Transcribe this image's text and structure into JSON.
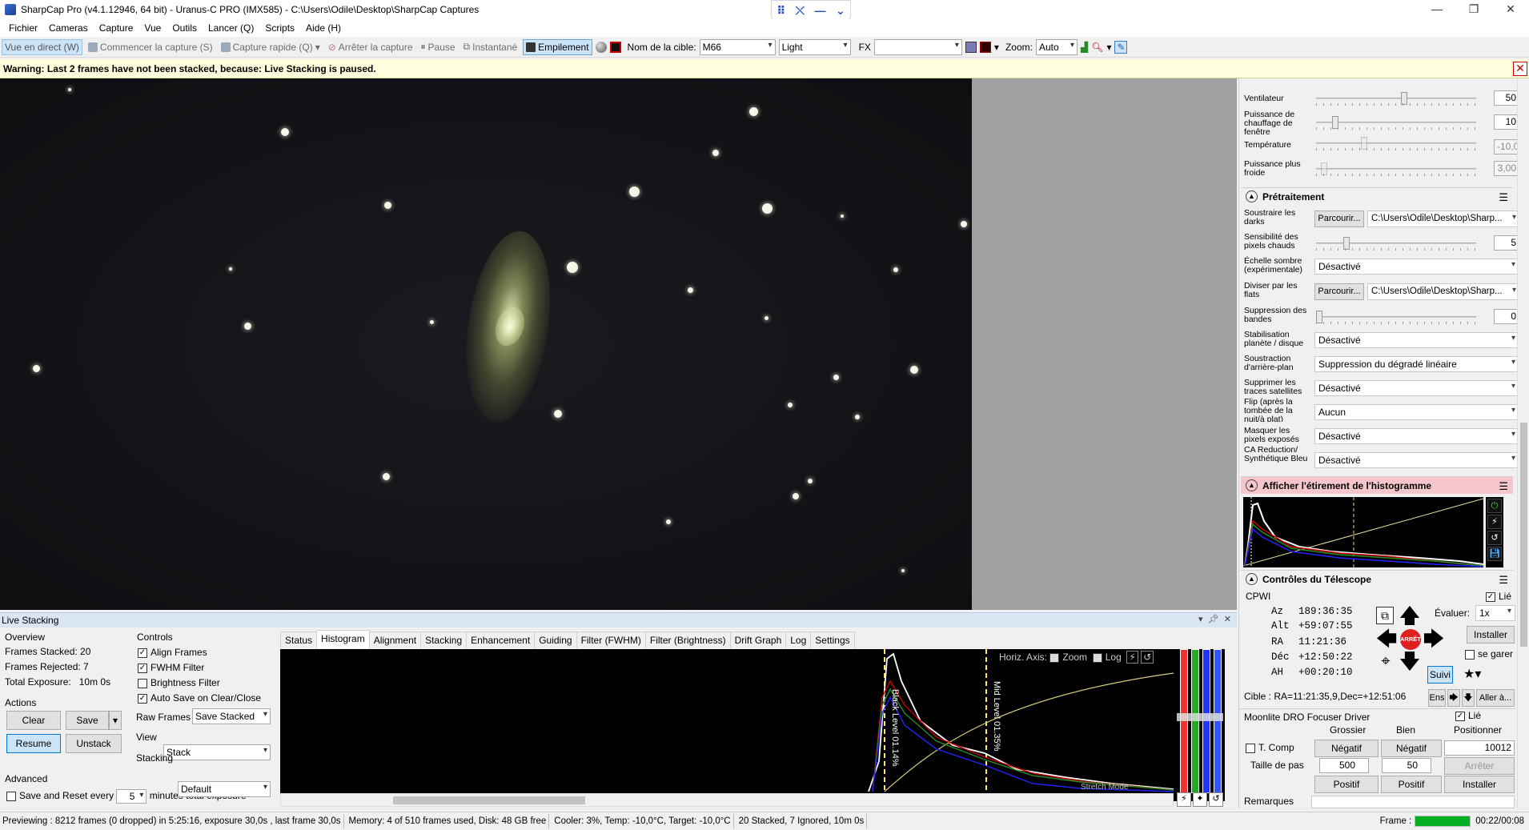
{
  "window": {
    "title": "SharpCap Pro (v4.1.12946, 64 bit) - Uranus-C PRO (IMX585) - C:\\Users\\Odile\\Desktop\\SharpCap Captures",
    "controls": [
      "—",
      "❐",
      "✕"
    ]
  },
  "menu": [
    "Fichier",
    "Cameras",
    "Capture",
    "Vue",
    "Outils",
    "Lancer (Q)",
    "Scripts",
    "Aide (H)"
  ],
  "toolbar": {
    "live_view": "Vue en direct (W)",
    "start_capture": "Commencer la capture (S)",
    "quick_capture": "Capture rapide (Q)",
    "stop_capture": "Arrêter la capture",
    "pause": "Pause",
    "snapshot": "Instantané",
    "stacking": "Empilement",
    "target_label": "Nom de la cible:",
    "target_value": "M66",
    "frame_type": "Light",
    "fx_label": "FX",
    "fx_value": "",
    "zoom_label": "Zoom:",
    "zoom_value": "Auto"
  },
  "warning": "Warning: Last 2 frames have not been stacked, because: Live Stacking is paused.",
  "right_panel": {
    "camera_rows": [
      {
        "label": "Ventilateur",
        "value": "50",
        "level": 0.45,
        "disabled": false
      },
      {
        "label": "Puissance de chauffage de fenêtre",
        "value": "10",
        "level": 0.1,
        "disabled": false
      },
      {
        "label": "Température",
        "value": "-10,0",
        "level": 0.25,
        "disabled": true
      },
      {
        "label": "Puissance plus froide",
        "value": "3,00",
        "level": 0.03,
        "disabled": true
      }
    ],
    "preprocessing": {
      "title": "Prétraitement",
      "subtract_darks_label": "Soustraire les darks",
      "browse_label": "Parcourir...",
      "darks_path": "C:\\Users\\Odile\\Desktop\\Sharp...",
      "hot_pixel_label": "Sensibilité des pixels chauds",
      "hot_pixel_value": "5",
      "dark_scale_label": "Échelle sombre (expérimentale)",
      "dark_scale_value": "Désactivé",
      "flats_label": "Diviser par les flats",
      "flats_path": "C:\\Users\\Odile\\Desktop\\Sharp...",
      "banding_label": "Suppression des bandes",
      "banding_value": "0",
      "stabilization_label": "Stabilisation planète / disque",
      "stabilization_value": "Désactivé",
      "background_label": "Soustraction d'arrière-plan",
      "background_value": "Suppression du dégradé linéaire",
      "satellite_label": "Supprimer les traces satellites",
      "satellite_value": "Désactivé",
      "flip_label": "Flip (après la tombée de la nuit/à plat)",
      "flip_value": "Aucun",
      "mask_label": "Masquer les pixels exposés",
      "mask_value": "Désactivé",
      "synthetic_label": "CA Reduction/ Synthétique Bleu",
      "synthetic_value": "Désactivé"
    },
    "histogram_title": "Afficher l'étirement de l'histogramme",
    "telescope": {
      "title": "Contrôles du Télescope",
      "driver": "CPWI",
      "linked_label": "Lié",
      "az_label": "Az",
      "az": "189:36:35",
      "alt_label": "Alt",
      "alt": "+59:07:55",
      "ra_label": "RA",
      "ra": "11:21:36",
      "dec_label": "Déc",
      "dec": "+12:50:22",
      "ha_label": "AH",
      "ha": "+00:20:10",
      "stop_label": "ARRÊTE",
      "evaluate_label": "Évaluer:",
      "rate_value": "1x",
      "install_label": "Installer",
      "park_label": "se garer",
      "track_label": "Suivi",
      "target_text": "Cible : RA=11:21:35,9,Dec=+12:51:06",
      "set_label": "Ens",
      "goto_label": "Aller à..."
    },
    "focuser": {
      "title": "Moonlite DRO Focuser Driver",
      "linked_label": "Lié",
      "coarse_label": "Grossier",
      "fine_label": "Bien",
      "position_label": "Positionner",
      "tcomp_label": "T. Comp",
      "negative_label": "Négatif",
      "position_value": "10012",
      "step_label": "Taille de pas",
      "coarse_step": "500",
      "fine_step": "50",
      "stop_label": "Arrêter",
      "positive_label": "Positif",
      "install_label": "Installer"
    },
    "remarks_label": "Remarques"
  },
  "live_stacking": {
    "title": "Live Stacking",
    "overview_label": "Overview",
    "frames_stacked_label": "Frames Stacked:",
    "frames_stacked": "20",
    "frames_rejected_label": "Frames Rejected:",
    "frames_rejected": "7",
    "total_exposure_label": "Total Exposure:",
    "total_exposure": "10m 0s",
    "actions_label": "Actions",
    "clear_label": "Clear",
    "save_label": "Save",
    "resume_label": "Resume",
    "unstack_label": "Unstack",
    "advanced_label": "Advanced",
    "save_reset_label": "Save and Reset every",
    "save_reset_value": "5",
    "save_reset_suffix": "minutes total exposure",
    "controls_label": "Controls",
    "align_frames": "Align Frames",
    "fwhm_filter": "FWHM Filter",
    "brightness_filter": "Brightness Filter",
    "auto_save": "Auto Save on Clear/Close",
    "raw_frames_label": "Raw Frames",
    "raw_frames_value": "Save Stacked",
    "view_label": "View",
    "view_value": "Stack",
    "stacking_label": "Stacking",
    "stacking_value": "Default",
    "tabs": [
      "Status",
      "Histogram",
      "Alignment",
      "Stacking",
      "Enhancement",
      "Guiding",
      "Filter (FWHM)",
      "Filter (Brightness)",
      "Drift Graph",
      "Log",
      "Settings"
    ],
    "horiz_axis_label": "Horiz. Axis:",
    "zoom_label": "Zoom",
    "log_label": "Log",
    "black_level": "Black Level 01.14%",
    "mid_level": "Mid Level 01.35%",
    "stretch_label": "Stretch Mode"
  },
  "status_bar": {
    "preview": "Previewing : 8212 frames (0 dropped) in 5:25:16, exposure 30,0s , last frame 30,0s",
    "memory": "Memory: 4 of 510 frames used, Disk: 48 GB free",
    "cooler": "Cooler: 3%, Temp: -10,0°C, Target: -10,0°C",
    "stack": "20 Stacked, 7 Ignored, 10m 0s",
    "frame_label": "Frame :",
    "frame_time": "00:22/00:08"
  },
  "colors": {
    "accent": "#0078d7",
    "warning_bg": "#ffffdd",
    "progress": "#06b025"
  }
}
